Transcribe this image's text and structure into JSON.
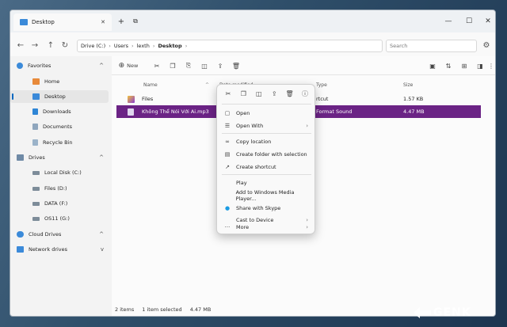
{
  "window": {
    "tab_title": "Desktop",
    "tab_close": "✕",
    "new_tab": "+",
    "minimize": "—",
    "maximize": "☐",
    "close": "✕"
  },
  "nav": {
    "breadcrumb": [
      "Drive (C:)",
      "Users",
      "lexth",
      "Desktop"
    ],
    "search_placeholder": "Search"
  },
  "sidebar": {
    "items": [
      {
        "label": "Favorites",
        "group": true
      },
      {
        "label": "Home"
      },
      {
        "label": "Desktop",
        "selected": true
      },
      {
        "label": "Downloads"
      },
      {
        "label": "Documents"
      },
      {
        "label": "Recycle Bin"
      },
      {
        "label": "Drives",
        "group": true
      },
      {
        "label": "Local Disk (C:)"
      },
      {
        "label": "Files (D:)"
      },
      {
        "label": "DATA (F:)"
      },
      {
        "label": "OS11 (G:)"
      },
      {
        "label": "Cloud Drives",
        "group": true
      },
      {
        "label": "Network drives",
        "group": true
      }
    ]
  },
  "toolbar": {
    "new_label": "New"
  },
  "columns": {
    "name": "Name",
    "date": "Date modified",
    "type": "Type",
    "size": "Size"
  },
  "files": [
    {
      "name": "Files",
      "type": "rtcut",
      "size": "1.57 KB"
    },
    {
      "name": "Không Thể Nói Với Ai.mp3",
      "type": "Format Sound",
      "size": "4.47 MB"
    }
  ],
  "status": {
    "items": "2 items",
    "selected": "1 item selected",
    "size": "4.47 MB"
  },
  "context_menu": {
    "items": [
      {
        "label": "Open"
      },
      {
        "label": "Open With"
      },
      {
        "label": "Copy location"
      },
      {
        "label": "Create folder with selection"
      },
      {
        "label": "Create shortcut"
      },
      {
        "label": "Play"
      },
      {
        "label": "Add to Windows Media Player..."
      },
      {
        "label": "Share with Skype"
      },
      {
        "label": "Cast to Device"
      },
      {
        "label": "More"
      }
    ]
  },
  "watermark": "GENK",
  "colors": {
    "selection": "#6b2385",
    "accent": "#0067c0"
  }
}
